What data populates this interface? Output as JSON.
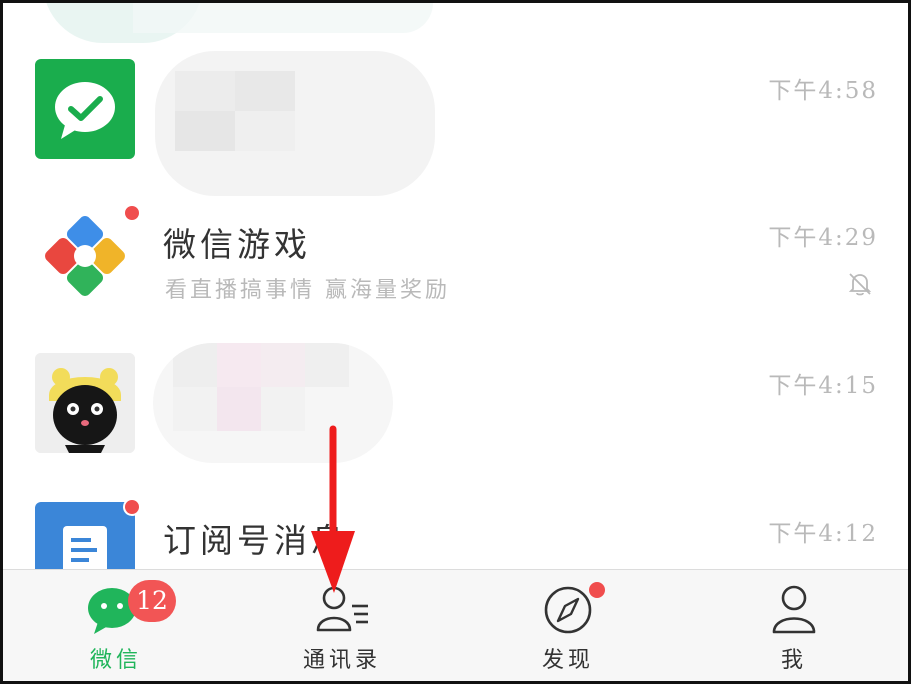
{
  "chats": [
    {
      "id": "wechat-pay",
      "name": "",
      "preview": "",
      "time": "下午4:58",
      "muted": false,
      "unread_dot": false,
      "avatar": "wechat-pay-icon"
    },
    {
      "id": "wechat-games",
      "name": "微信游戏",
      "preview": "看直播搞事情 赢海量奖励",
      "time": "下午4:29",
      "muted": true,
      "unread_dot": true,
      "avatar": "wechat-games-icon"
    },
    {
      "id": "cartoon-contact",
      "name": "",
      "preview": "",
      "time": "下午4:15",
      "muted": false,
      "unread_dot": false,
      "avatar": "cartoon-avatar"
    },
    {
      "id": "subscriptions",
      "name": "订阅号消息",
      "preview": "",
      "time": "下午4:12",
      "muted": false,
      "unread_dot": true,
      "avatar": "subscription-icon"
    }
  ],
  "tabbar": {
    "tabs": [
      {
        "id": "chats",
        "label": "微信",
        "badge": "12",
        "active": true,
        "icon": "chat-bubbles-icon"
      },
      {
        "id": "contacts",
        "label": "通讯录",
        "badge": "",
        "active": false,
        "icon": "contacts-icon"
      },
      {
        "id": "discover",
        "label": "发现",
        "badge": "",
        "active": false,
        "dot": true,
        "icon": "compass-icon"
      },
      {
        "id": "me",
        "label": "我",
        "badge": "",
        "active": false,
        "icon": "person-icon"
      }
    ]
  },
  "colors": {
    "accent": "#20b55b",
    "badge": "#f25555",
    "annotation_arrow": "#ee1c1c",
    "muted_text": "#b9b9b9"
  }
}
